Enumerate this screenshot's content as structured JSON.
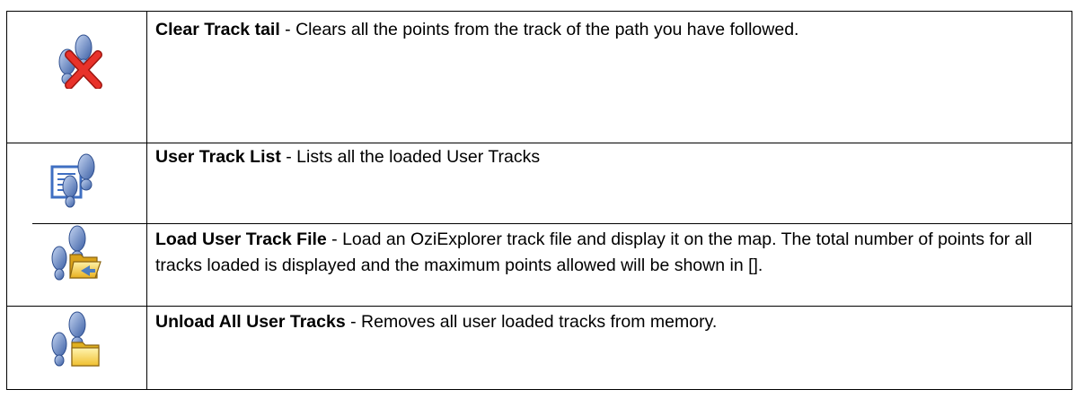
{
  "rows": [
    {
      "icon": "footprints-red-x-icon",
      "name": "Clear Track tail",
      "description": " - Clears all the points from the track of the path you have followed."
    },
    {
      "icon": "footprints-list-icon",
      "name": "User Track List",
      "description": " - Lists all the loaded User Tracks"
    },
    {
      "icon": "footprints-open-folder-icon",
      "name": "Load User Track File",
      "description": " - Load an OziExplorer track file and display it on the map. The total number of points for all tracks loaded is displayed and the maximum points allowed will be shown in []."
    },
    {
      "icon": "footprints-folder-icon",
      "name": "Unload All User Tracks",
      "description": " - Removes all user loaded tracks from memory."
    }
  ],
  "colors": {
    "footprint": "#6f8fc7",
    "footprint_dark": "#2f4f8f",
    "red_x": "#d8231c",
    "folder": "#f4c430",
    "folder_dark": "#b8860b",
    "list_blue": "#3f6fc2"
  }
}
